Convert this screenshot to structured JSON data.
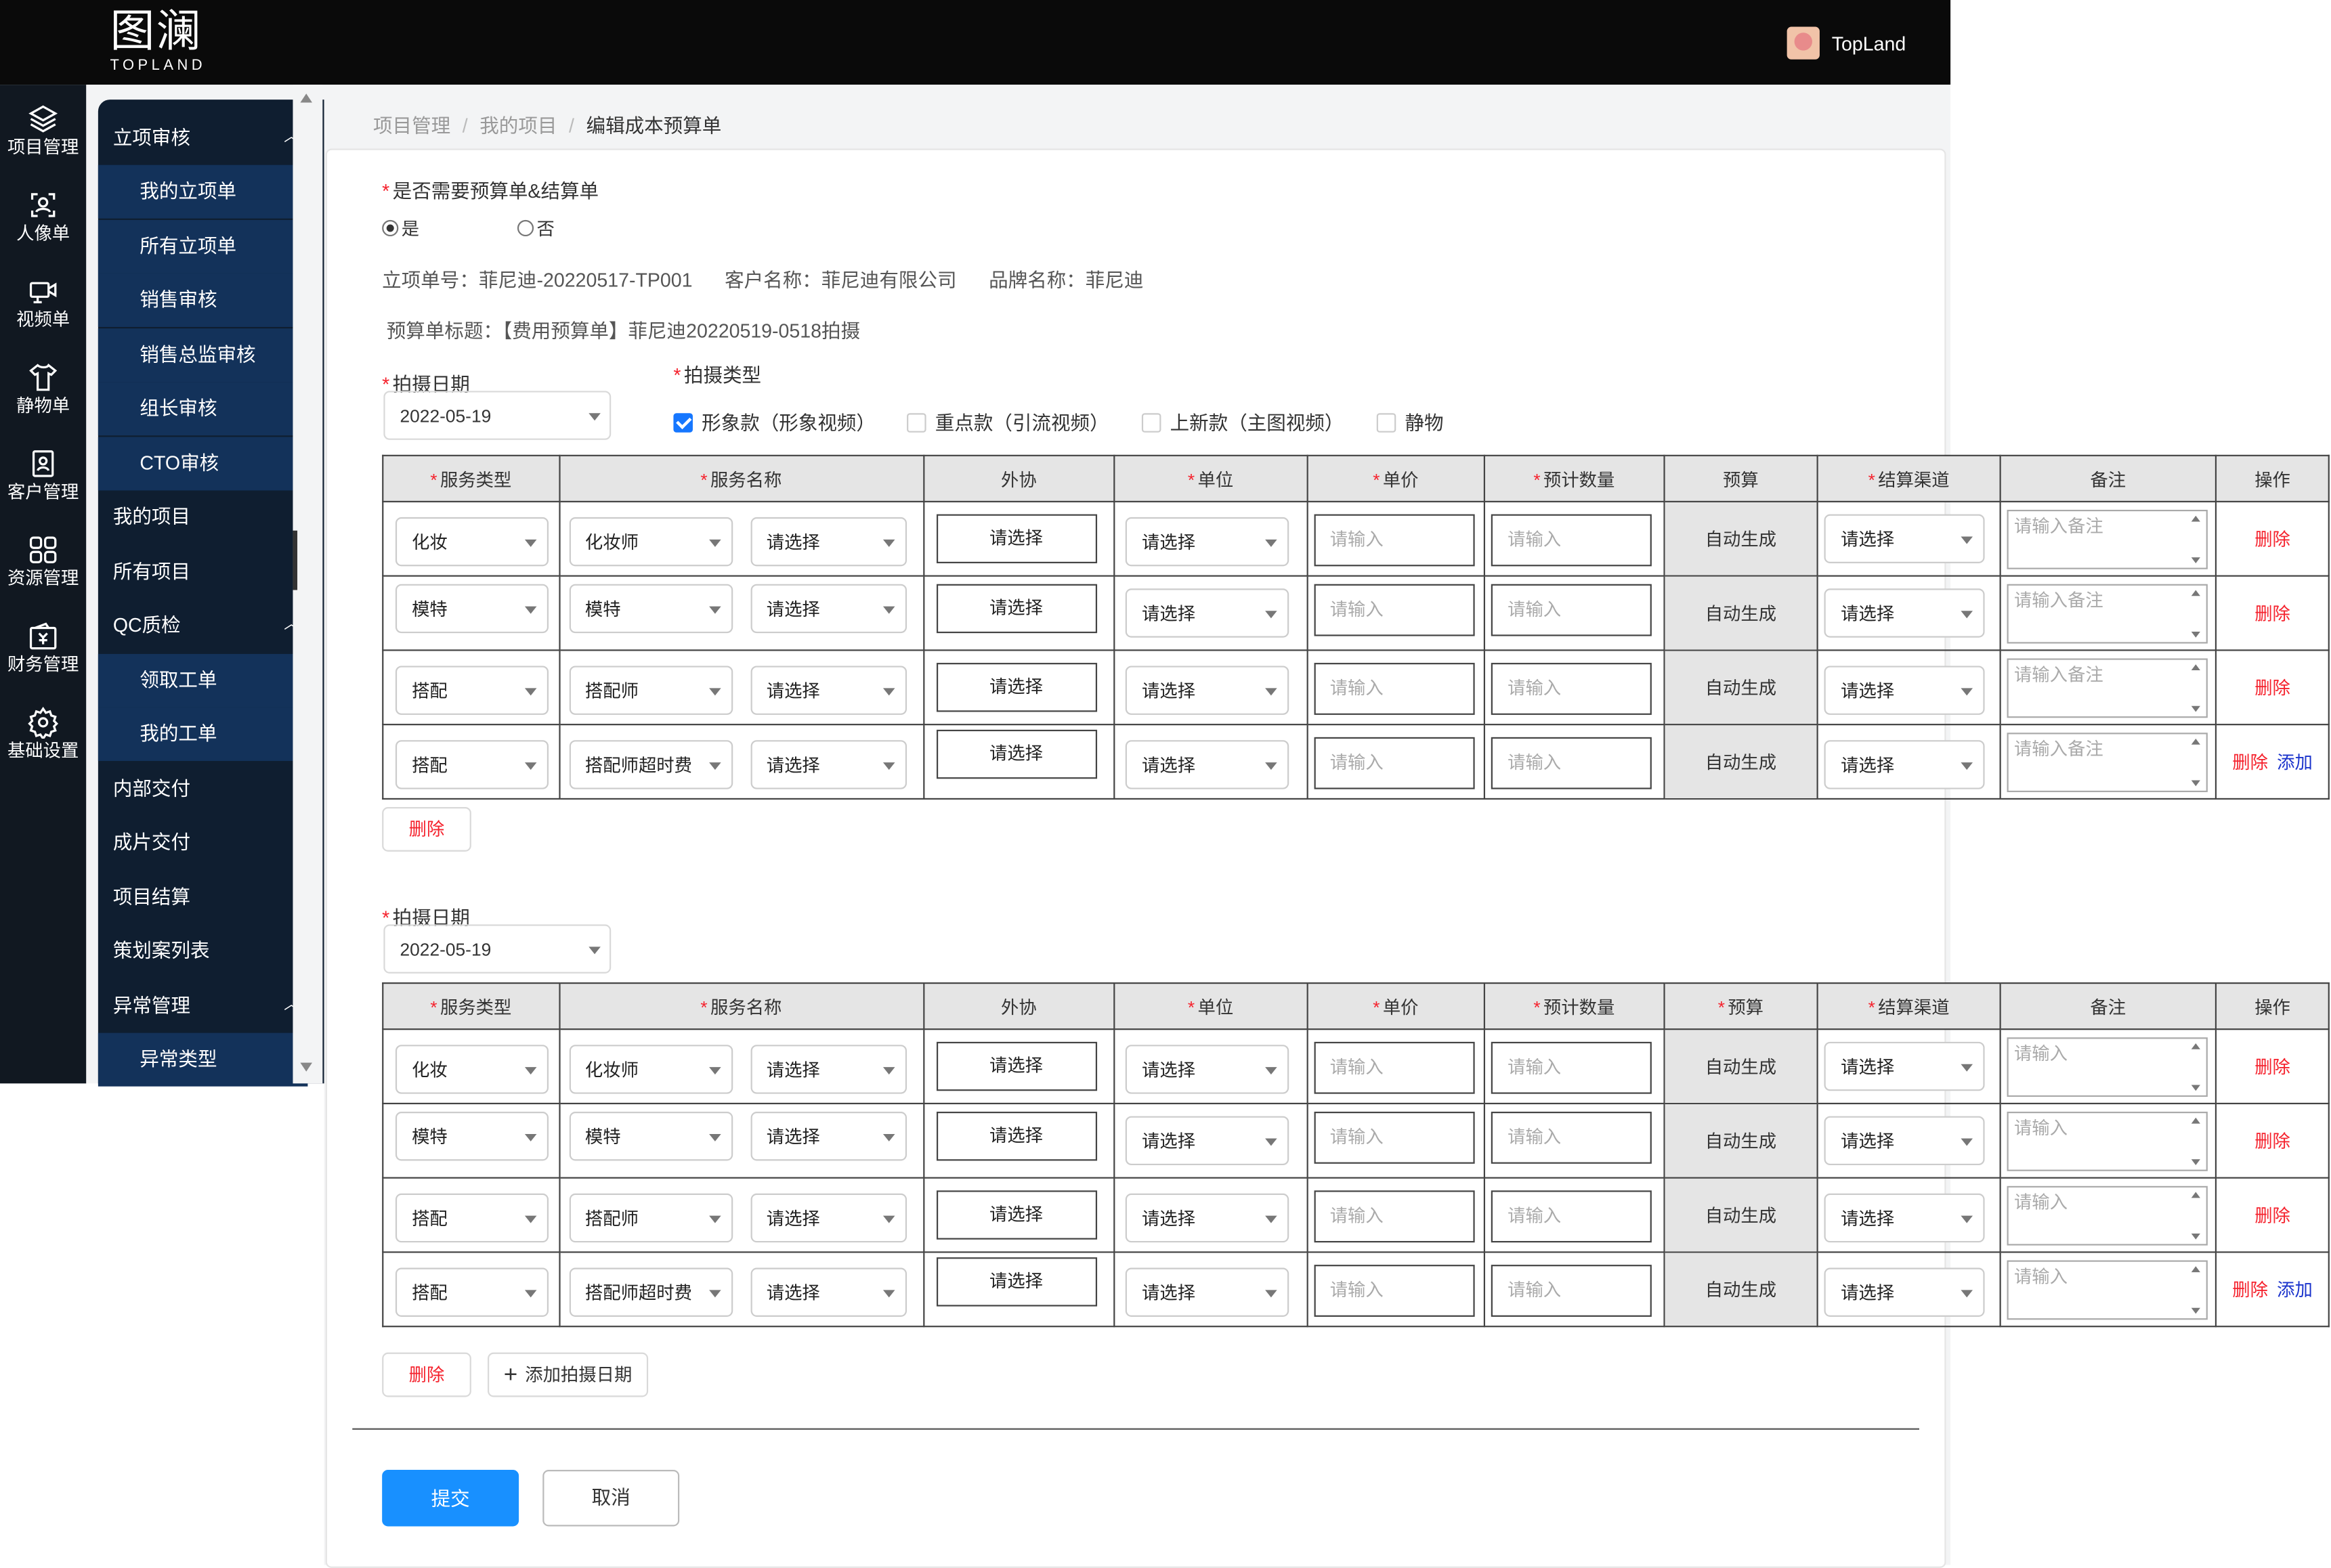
{
  "logo": {
    "big": "图澜",
    "small": "TOPLAND"
  },
  "user": {
    "name": "TopLand"
  },
  "rail": [
    {
      "icon": "layers-icon",
      "label": "项目管理"
    },
    {
      "icon": "portrait-icon",
      "label": "人像单"
    },
    {
      "icon": "video-icon",
      "label": "视频单"
    },
    {
      "icon": "shirt-icon",
      "label": "静物单"
    },
    {
      "icon": "contact-icon",
      "label": "客户管理"
    },
    {
      "icon": "grid-icon",
      "label": "资源管理"
    },
    {
      "icon": "wallet-icon",
      "label": "财务管理"
    },
    {
      "icon": "gear-icon",
      "label": "基础设置"
    }
  ],
  "submenu": {
    "g1": "立项审核",
    "g1_items": [
      "我的立项单",
      "所有立项单",
      "销售审核",
      "销售总监审核",
      "组长审核",
      "CTO审核"
    ],
    "my_projects": "我的项目",
    "all_projects": "所有项目",
    "g2": "QC质检",
    "g2_items": [
      "领取工单",
      "我的工单"
    ],
    "internal_delivery": "内部交付",
    "final_delivery": "成片交付",
    "settlement": "项目结算",
    "cases": "策划案列表",
    "g3": "异常管理",
    "g3_items": [
      "异常类型"
    ]
  },
  "breadcrumb": {
    "l1": "项目管理",
    "sep": "/",
    "l2": "我的项目",
    "current": "编辑成本预算单"
  },
  "form": {
    "star": "*",
    "need_label": "是否需要预算单&结算单",
    "yes": "是",
    "no": "否",
    "info_line": "立项单号：菲尼迪-20220517-TP001      客户名称：菲尼迪有限公司      品牌名称：菲尼迪",
    "title_line": "预算单标题：【费用预算单】菲尼迪20220519-0518拍摄",
    "date_label": "拍摄日期",
    "type_label": "拍摄类型",
    "types": [
      "形象款（形象视频）",
      "重点款（引流视频）",
      "上新款（主图视频）",
      "静物"
    ],
    "date1": "2022-05-19",
    "date2": "2022-05-19"
  },
  "table": {
    "h": [
      "服务类型",
      "服务名称",
      "外协",
      "单位",
      "单价",
      "预计数量",
      "预算",
      "结算渠道",
      "备注",
      "操作"
    ],
    "select": "请选择",
    "input": "请输入",
    "auto": "自动生成",
    "delete": "删除",
    "add": "添加",
    "memo1": "请输入备注",
    "memo2": "请输入",
    "rows": [
      {
        "type": "化妆",
        "name": "化妆师"
      },
      {
        "type": "模特",
        "name": "模特"
      },
      {
        "type": "搭配",
        "name": "搭配师"
      },
      {
        "type": "搭配",
        "name": "搭配师超时费"
      }
    ]
  },
  "buttons": {
    "delete": "删除",
    "add_date": "添加拍摄日期",
    "submit": "提交",
    "cancel": "取消"
  },
  "colors": {
    "primary": "#1890ff",
    "danger": "#f5222d",
    "menu_bg": "#0f1e30",
    "menu_child": "#13325a"
  }
}
